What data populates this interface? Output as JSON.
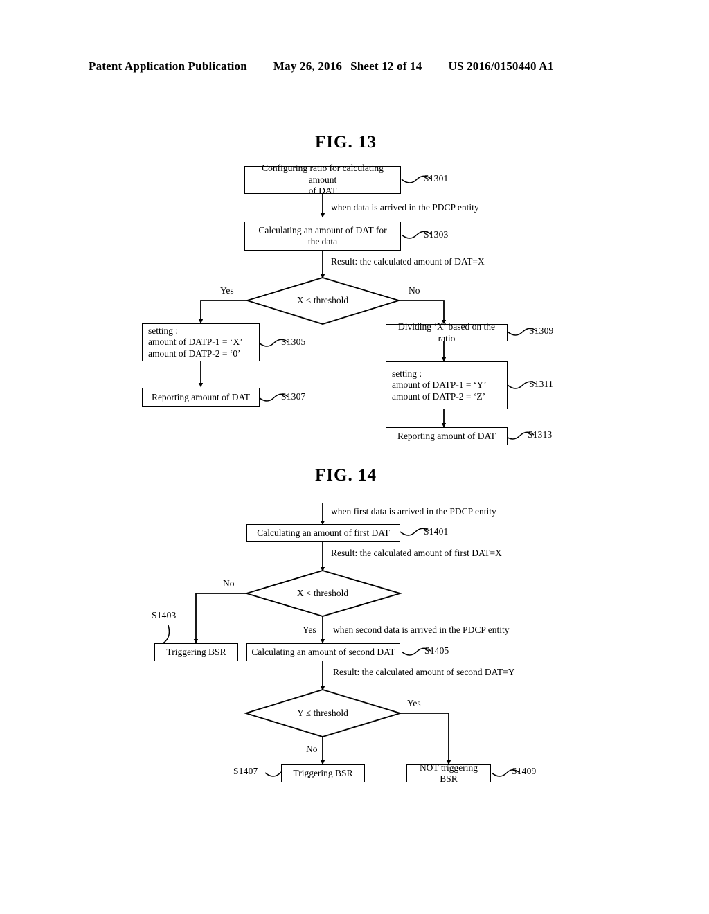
{
  "header": {
    "publication": "Patent Application Publication",
    "date": "May 26, 2016",
    "sheet": "Sheet 12 of 14",
    "patent_number": "US 2016/0150440 A1"
  },
  "figures": [
    {
      "title": "FIG. 13",
      "boxes": [
        {
          "id": "S1301",
          "text_lines": [
            "Configuring ratio for calculating amount",
            "of DAT"
          ]
        },
        {
          "id": "S1303",
          "text_lines": [
            "Calculating an amount of DAT for",
            "the data"
          ]
        },
        {
          "id": "S1305",
          "text_lines": [
            "setting :",
            "amount of DATP-1 = ‘X’",
            "amount of DATP-2 = ‘0’"
          ]
        },
        {
          "id": "S1307",
          "text_lines": [
            "Reporting amount of DAT"
          ]
        },
        {
          "id": "S1309",
          "text_lines": [
            "Dividing ‘X’ based on the ratio"
          ]
        },
        {
          "id": "S1311",
          "text_lines": [
            "setting :",
            "amount of DATP-1 = ‘Y’",
            "amount of DATP-2 = ‘Z’"
          ]
        },
        {
          "id": "S1313",
          "text_lines": [
            "Reporting amount of DAT"
          ]
        }
      ],
      "decisions": [
        {
          "label": "X < threshold",
          "yes": "Yes",
          "no": "No"
        }
      ],
      "annotations": [
        "when data is arrived in the PDCP entity",
        "Result: the calculated amount of DAT=X"
      ]
    },
    {
      "title": "FIG. 14",
      "boxes": [
        {
          "id": "S1401",
          "text_lines": [
            "Calculating an amount of first DAT"
          ]
        },
        {
          "id": "S1403",
          "text_lines": [
            "Triggering BSR"
          ]
        },
        {
          "id": "S1405",
          "text_lines": [
            "Calculating an amount of second DAT"
          ]
        },
        {
          "id": "S1407",
          "text_lines": [
            "Triggering BSR"
          ]
        },
        {
          "id": "S1409",
          "text_lines": [
            "NOT triggering BSR"
          ]
        }
      ],
      "decisions": [
        {
          "label": "X < threshold",
          "yes": "Yes",
          "no": "No"
        },
        {
          "label": "Y ≤ threshold",
          "yes": "Yes",
          "no": "No"
        }
      ],
      "annotations": [
        "when first data is arrived in the PDCP entity",
        "Result: the calculated amount of first DAT=X",
        "when second data is arrived in the PDCP entity",
        "Result: the calculated amount of second DAT=Y"
      ]
    }
  ],
  "fig13": {
    "title": "FIG. 13",
    "s1301_l1": "Configuring ratio for calculating amount",
    "s1301_l2": "of DAT",
    "s1301_ref": "S1301",
    "note_pdcp": "when data is arrived in the PDCP entity",
    "s1303_l1": "Calculating an amount of DAT for",
    "s1303_l2": "the data",
    "s1303_ref": "S1303",
    "note_result": "Result: the calculated amount of DAT=X",
    "decision": "X < threshold",
    "yes": "Yes",
    "no": "No",
    "s1305_l1": "setting :",
    "s1305_l2": "amount of DATP-1 = ‘X’",
    "s1305_l3": "amount of DATP-2 = ‘0’",
    "s1305_ref": "S1305",
    "s1307_l1": "Reporting amount of DAT",
    "s1307_ref": "S1307",
    "s1309_l1": "Dividing ‘X’ based on the ratio",
    "s1309_ref": "S1309",
    "s1311_l1": "setting :",
    "s1311_l2": "amount of DATP-1 = ‘Y’",
    "s1311_l3": "amount of DATP-2 = ‘Z’",
    "s1311_ref": "S1311",
    "s1313_l1": "Reporting amount of DAT",
    "s1313_ref": "S1313"
  },
  "fig14": {
    "title": "FIG. 14",
    "note_first_pdcp": "when first data is arrived in the PDCP entity",
    "s1401_l1": "Calculating an amount of first DAT",
    "s1401_ref": "S1401",
    "note_result_first": "Result: the calculated amount of first DAT=X",
    "decision1": "X < threshold",
    "d1_no": "No",
    "d1_yes": "Yes",
    "s1403_ref": "S1403",
    "s1403_l1": "Triggering BSR",
    "note_second_pdcp": "when second data is arrived in the PDCP entity",
    "s1405_l1": "Calculating an amount of second DAT",
    "s1405_ref": "S1405",
    "note_result_second": "Result: the calculated amount of second DAT=Y",
    "decision2": "Y ≤ threshold",
    "d2_yes": "Yes",
    "d2_no": "No",
    "s1407_ref": "S1407",
    "s1407_l1": "Triggering BSR",
    "s1409_l1": "NOT triggering BSR",
    "s1409_ref": "S1409"
  },
  "colors": {
    "ink": "#000000",
    "paper": "#ffffff"
  }
}
